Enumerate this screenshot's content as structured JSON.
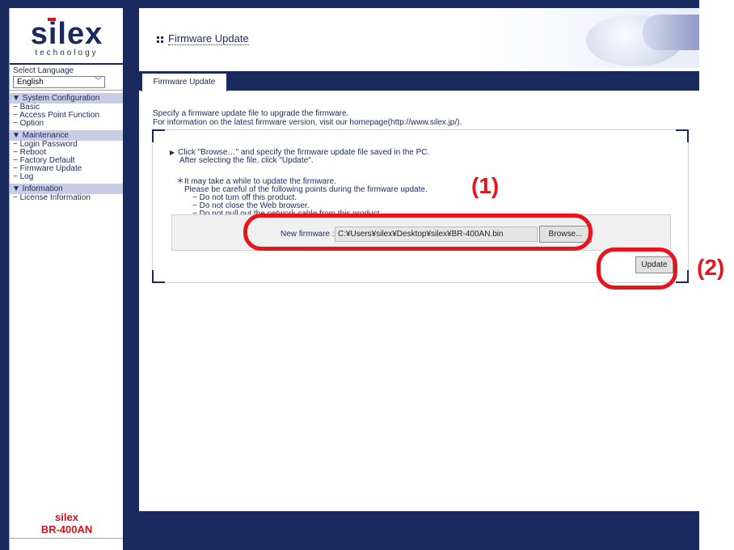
{
  "sidebar": {
    "logo_word": "silex",
    "logo_sub": "technology",
    "language_label": "Select Language",
    "language_value": "English",
    "sections": [
      {
        "title": "▼ System Configuration",
        "items": [
          "− Basic",
          "− Access Point Function",
          "− Option"
        ]
      },
      {
        "title": "▼ Maintenance",
        "items": [
          "− Login Password",
          "− Reboot",
          "− Factory Default",
          "− Firmware Update",
          "− Log"
        ]
      },
      {
        "title": "▼ Information",
        "items": [
          "− License Information"
        ]
      }
    ],
    "model_brand": "silex",
    "model_name": "BR-400AN"
  },
  "header": {
    "title": "Firmware Update"
  },
  "tab": {
    "label": "Firmware Update"
  },
  "intro": {
    "line1": "Specify a firmware update file to upgrade the firmware.",
    "line2": "For information on the latest firmware version, visit our homepage(http://www.silex.jp/)."
  },
  "instructions": {
    "line1": "Click \"Browse…\" and specify the firmware update file saved in the PC.",
    "line2": "After selecting the file, click \"Update\"."
  },
  "notes": {
    "line1": "＊It may take a while to update the firmware.",
    "line2": "Please be careful of the following points during the firmware update.",
    "line3": "− Do not turn off this product.",
    "line4": "− Do not close the Web browser.",
    "line5": "− Do not pull out the network cable from this product."
  },
  "firmware": {
    "label": "New firmware :",
    "path": "C:¥Users¥silex¥Desktop¥silex¥BR-400AN.bin",
    "browse_label": "Browse..."
  },
  "update_label": "Update",
  "annotations": {
    "label1": "(1)",
    "label2": "(2)",
    "color": "#e8141c"
  },
  "colors": {
    "navy": "#1b2a5e",
    "brand_red": "#d0151d"
  }
}
